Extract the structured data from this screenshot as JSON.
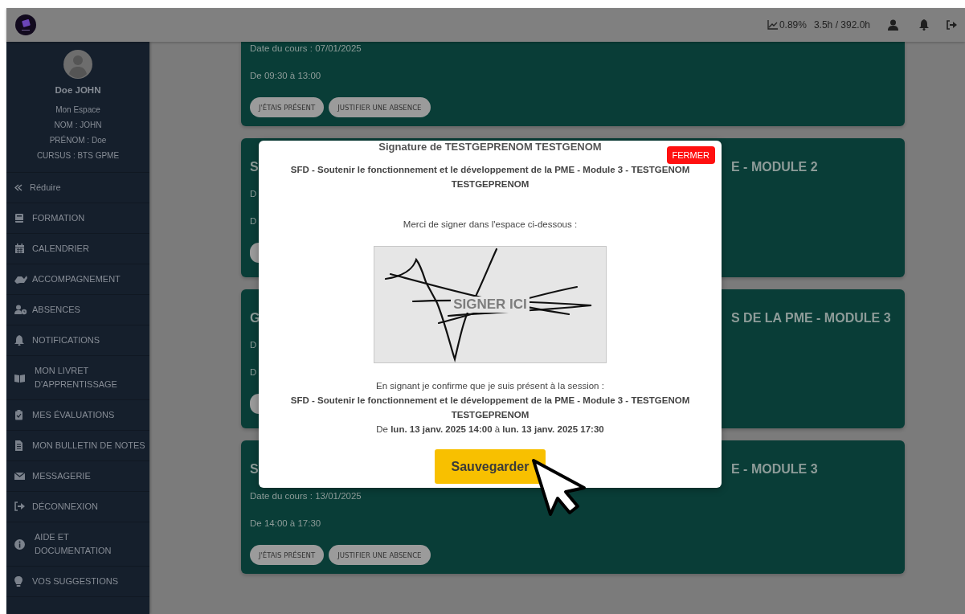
{
  "topbar": {
    "progress": "0.89%",
    "hours": "3.5h / 392.0h"
  },
  "sidebar": {
    "profile": {
      "name": "Doe JOHN",
      "lines": [
        "Mon Espace",
        "NOM : JOHN",
        "PRÉNOM : Doe",
        "CURSUS : BTS GPME"
      ]
    },
    "collapse": "Réduire",
    "items": [
      {
        "kind": "single",
        "label": "FORMATION"
      },
      {
        "kind": "single",
        "label": "CALENDRIER"
      },
      {
        "kind": "single",
        "label": "ACCOMPAGNEMENT"
      },
      {
        "kind": "single",
        "label": "ABSENCES"
      },
      {
        "kind": "single",
        "label": "NOTIFICATIONS"
      },
      {
        "kind": "double",
        "label": "MON LIVRET D'APPRENTISSAGE"
      },
      {
        "kind": "single",
        "label": "MES ÉVALUATIONS"
      },
      {
        "kind": "single",
        "label": "MON BULLETIN DE NOTES"
      },
      {
        "kind": "single",
        "label": "MESSAGERIE"
      },
      {
        "kind": "single",
        "label": "DÉCONNEXION"
      },
      {
        "kind": "double",
        "label": "AIDE ET DOCUMENTATION"
      },
      {
        "kind": "single",
        "label": "VOS SUGGESTIONS"
      }
    ]
  },
  "cards": [
    {
      "kind": "clipped",
      "date": "Date du cours : 07/01/2025",
      "time": "De 09:30 à 13:00",
      "buttons": [
        "J'ÉTAIS PRÉSENT",
        "JUSTIFIER UNE ABSENCE"
      ]
    },
    {
      "kind": "covered",
      "title_start": "S",
      "title_end": "E - MODULE 2",
      "date": "D",
      "time": "D"
    },
    {
      "kind": "covered",
      "title_start": "G",
      "title_end": "S DE LA PME - MODULE 3",
      "date": "D",
      "time": "D"
    },
    {
      "kind": "full",
      "title_start": "S",
      "title_end": "E - MODULE 3",
      "date": "Date du cours : 13/01/2025",
      "time": "De 14:00 à 17:30",
      "buttons": [
        "J'ÉTAIS PRÉSENT",
        "JUSTIFIER UNE ABSENCE"
      ]
    }
  ],
  "modal": {
    "heading": "Signature de TESTGEPRENOM TESTGENOM",
    "close": "FERMER",
    "title": "SFD - Soutenir le fonctionnement et le développement de la PME - Module 3 - TESTGENOM TESTGEPRENOM",
    "instruction": "Merci de signer dans l'espace ci-dessous :",
    "pad": {
      "placeholder": "SIGNER ICI"
    },
    "confirm": "En signant je confirme que je suis présent à la session :",
    "course": "SFD - Soutenir le fonctionnement et le développement de la PME - Module 3 - TESTGENOM TESTGEPRENOM",
    "period": "De **lun. 13 janv. 2025 14:00** à **lun. 13 janv. 2025 17:30**",
    "save": "Sauvegarder"
  }
}
